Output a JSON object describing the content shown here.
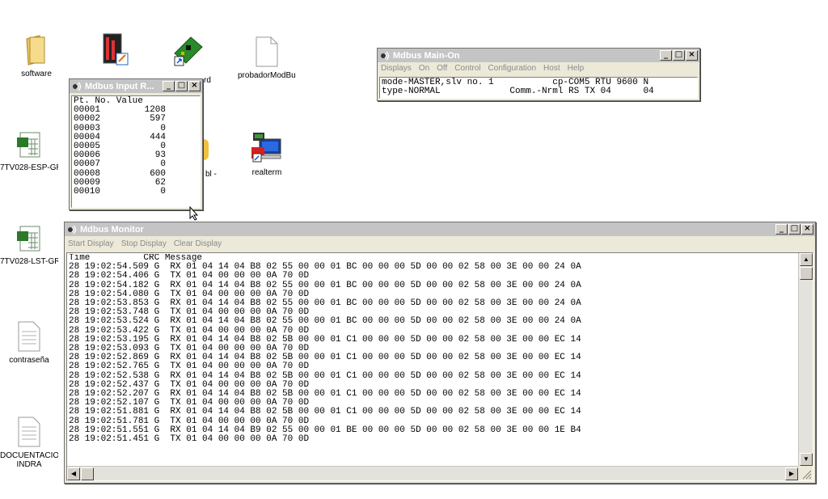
{
  "desktop": {
    "icons": [
      {
        "label": "software"
      },
      {
        "label": ""
      },
      {
        "label": ""
      },
      {
        "label": "probadorModBu..."
      },
      {
        "label": "7TV028-ESP-GR..."
      },
      {
        "label": "realterm"
      },
      {
        "label": "7TV028-LST-GR..."
      },
      {
        "label": "contraseña"
      },
      {
        "label": "DOCUENTACION INDRA"
      }
    ],
    "partial_labels": {
      "top_right": "rd",
      "mid": "bl -"
    }
  },
  "input_window": {
    "title": "Mdbus Input R...",
    "header": "Pt. No. Value",
    "rows": [
      {
        "pt": "00001",
        "value": "1208"
      },
      {
        "pt": "00002",
        "value": "597"
      },
      {
        "pt": "00003",
        "value": "0"
      },
      {
        "pt": "00004",
        "value": "444"
      },
      {
        "pt": "00005",
        "value": "0"
      },
      {
        "pt": "00006",
        "value": "93"
      },
      {
        "pt": "00007",
        "value": "0"
      },
      {
        "pt": "00008",
        "value": "600"
      },
      {
        "pt": "00009",
        "value": "62"
      },
      {
        "pt": "00010",
        "value": "0"
      }
    ]
  },
  "main_window": {
    "title": "Mdbus Main-On",
    "menu": [
      "Displays",
      "On",
      "Off",
      "Control",
      "Configuration",
      "Host",
      "Help"
    ],
    "line1": "mode-MASTER,slv no. 1           cp-COM5 RTU 9600 N",
    "line2": "type-NORMAL             Comm.-Nrml RS TX 04      04"
  },
  "monitor_window": {
    "title": "Mdbus Monitor",
    "menu": [
      "Start Display",
      "Stop Display",
      "Clear Display"
    ],
    "header": "Time          CRC Message",
    "log": [
      "28 19:02:54.509 G  RX 01 04 14 04 B8 02 55 00 00 01 BC 00 00 00 5D 00 00 02 58 00 3E 00 00 24 0A",
      "28 19:02:54.406 G  TX 01 04 00 00 00 0A 70 0D",
      "28 19:02:54.182 G  RX 01 04 14 04 B8 02 55 00 00 01 BC 00 00 00 5D 00 00 02 58 00 3E 00 00 24 0A",
      "28 19:02:54.080 G  TX 01 04 00 00 00 0A 70 0D",
      "28 19:02:53.853 G  RX 01 04 14 04 B8 02 55 00 00 01 BC 00 00 00 5D 00 00 02 58 00 3E 00 00 24 0A",
      "28 19:02:53.748 G  TX 01 04 00 00 00 0A 70 0D",
      "28 19:02:53.524 G  RX 01 04 14 04 B8 02 55 00 00 01 BC 00 00 00 5D 00 00 02 58 00 3E 00 00 24 0A",
      "28 19:02:53.422 G  TX 01 04 00 00 00 0A 70 0D",
      "28 19:02:53.195 G  RX 01 04 14 04 B8 02 5B 00 00 01 C1 00 00 00 5D 00 00 02 58 00 3E 00 00 EC 14",
      "28 19:02:53.093 G  TX 01 04 00 00 00 0A 70 0D",
      "28 19:02:52.869 G  RX 01 04 14 04 B8 02 5B 00 00 01 C1 00 00 00 5D 00 00 02 58 00 3E 00 00 EC 14",
      "28 19:02:52.765 G  TX 01 04 00 00 00 0A 70 0D",
      "28 19:02:52.538 G  RX 01 04 14 04 B8 02 5B 00 00 01 C1 00 00 00 5D 00 00 02 58 00 3E 00 00 EC 14",
      "28 19:02:52.437 G  TX 01 04 00 00 00 0A 70 0D",
      "28 19:02:52.207 G  RX 01 04 14 04 B8 02 5B 00 00 01 C1 00 00 00 5D 00 00 02 58 00 3E 00 00 EC 14",
      "28 19:02:52.107 G  TX 01 04 00 00 00 0A 70 0D",
      "28 19:02:51.881 G  RX 01 04 14 04 B8 02 5B 00 00 01 C1 00 00 00 5D 00 00 02 58 00 3E 00 00 EC 14",
      "28 19:02:51.781 G  TX 01 04 00 00 00 0A 70 0D",
      "28 19:02:51.551 G  RX 01 04 14 04 B9 02 55 00 00 01 BE 00 00 00 5D 00 00 02 58 00 3E 00 00 1E B4",
      "28 19:02:51.451 G  TX 01 04 00 00 00 0A 70 0D"
    ]
  },
  "colors": {
    "active_title": "#7a96df",
    "inactive_title": "#c4c4c4",
    "window_face": "#ece9d8"
  }
}
